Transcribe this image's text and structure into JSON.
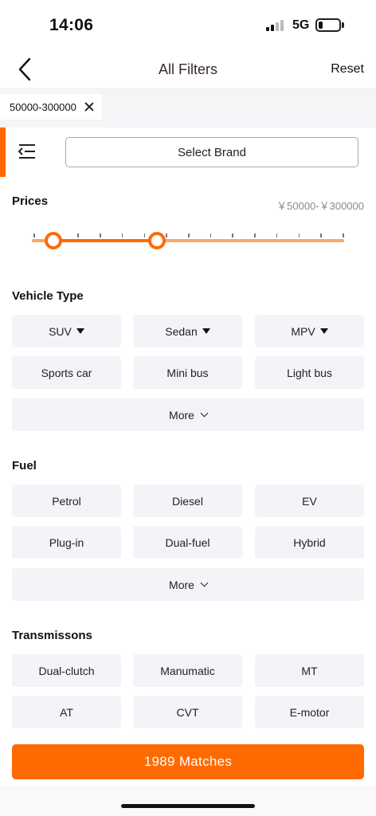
{
  "status_bar": {
    "time": "14:06",
    "network": "5G",
    "battery_level": 0.2
  },
  "nav": {
    "title": "All Filters",
    "reset_label": "Reset",
    "back_icon": "chevron-left-icon"
  },
  "active_filters": [
    {
      "label": "50000-300000",
      "remove_icon": "close-icon"
    }
  ],
  "brand": {
    "select_label": "Select Brand",
    "menu_icon": "list-indent-icon"
  },
  "prices": {
    "title": "Prices",
    "range_label": "￥50000-￥300000",
    "slider": {
      "low_fraction": 0.07,
      "high_fraction": 0.4,
      "ticks": 15
    }
  },
  "vehicle_type": {
    "title": "Vehicle Type",
    "options": [
      {
        "label": "SUV",
        "dropdown": true
      },
      {
        "label": "Sedan",
        "dropdown": true
      },
      {
        "label": "MPV",
        "dropdown": true
      },
      {
        "label": "Sports car"
      },
      {
        "label": "Mini bus"
      },
      {
        "label": "Light bus"
      }
    ],
    "more_label": "More"
  },
  "fuel": {
    "title": "Fuel",
    "options": [
      {
        "label": "Petrol"
      },
      {
        "label": "Diesel"
      },
      {
        "label": "EV"
      },
      {
        "label": "Plug-in"
      },
      {
        "label": "Dual-fuel"
      },
      {
        "label": "Hybrid"
      }
    ],
    "more_label": "More"
  },
  "transmissions": {
    "title": "Transmissons",
    "options": [
      {
        "label": "Dual-clutch"
      },
      {
        "label": "Manumatic"
      },
      {
        "label": "MT"
      },
      {
        "label": "AT"
      },
      {
        "label": "CVT"
      },
      {
        "label": "E-motor"
      }
    ]
  },
  "cta": {
    "label": "1989 Matches"
  },
  "colors": {
    "accent": "#ff6a00",
    "accent_light": "#f7a86a",
    "option_bg": "#f3f4f8",
    "chip_strip_bg": "#f4f5f7"
  }
}
